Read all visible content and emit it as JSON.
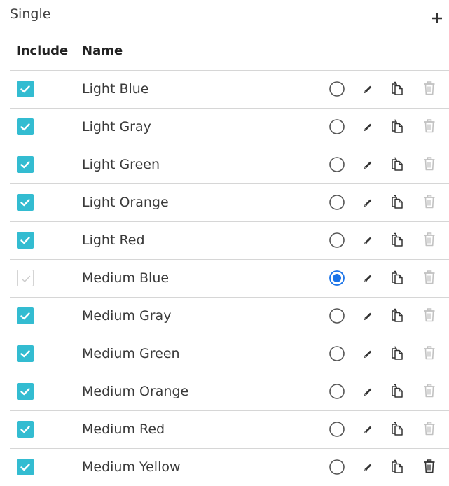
{
  "section": {
    "title": "Single"
  },
  "add_icon": "plus-icon",
  "table": {
    "headers": {
      "include": "Include",
      "name": "Name"
    },
    "rows": [
      {
        "name": "Light Blue",
        "included": true,
        "include_disabled": false,
        "selected": false,
        "delete_enabled": false
      },
      {
        "name": "Light Gray",
        "included": true,
        "include_disabled": false,
        "selected": false,
        "delete_enabled": false
      },
      {
        "name": "Light Green",
        "included": true,
        "include_disabled": false,
        "selected": false,
        "delete_enabled": false
      },
      {
        "name": "Light Orange",
        "included": true,
        "include_disabled": false,
        "selected": false,
        "delete_enabled": false
      },
      {
        "name": "Light Red",
        "included": true,
        "include_disabled": false,
        "selected": false,
        "delete_enabled": false
      },
      {
        "name": "Medium Blue",
        "included": true,
        "include_disabled": true,
        "selected": true,
        "delete_enabled": false
      },
      {
        "name": "Medium Gray",
        "included": true,
        "include_disabled": false,
        "selected": false,
        "delete_enabled": false
      },
      {
        "name": "Medium Green",
        "included": true,
        "include_disabled": false,
        "selected": false,
        "delete_enabled": false
      },
      {
        "name": "Medium Orange",
        "included": true,
        "include_disabled": false,
        "selected": false,
        "delete_enabled": false
      },
      {
        "name": "Medium Red",
        "included": true,
        "include_disabled": false,
        "selected": false,
        "delete_enabled": false
      },
      {
        "name": "Medium Yellow",
        "included": true,
        "include_disabled": false,
        "selected": false,
        "delete_enabled": true
      }
    ]
  },
  "colors": {
    "checkbox_checked": "#33bcd1",
    "checkbox_disabled_mark": "#cccccc",
    "radio_selected": "#1a73e8",
    "radio_border": "#555555",
    "icon_dark": "#333333",
    "icon_light": "#c2c2c2",
    "divider": "#d6d6d6"
  },
  "icons": {
    "checkbox": "checkmark-icon",
    "radio": "radio-icon",
    "edit": "pencil-icon",
    "copy": "copy-icon",
    "delete": "trash-icon"
  }
}
